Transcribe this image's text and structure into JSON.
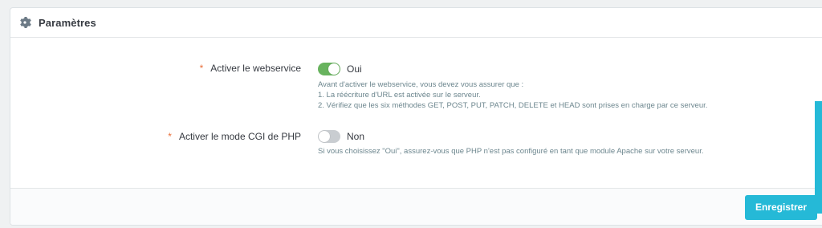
{
  "panel": {
    "title": "Paramètres",
    "icon": "gear-icon"
  },
  "fields": [
    {
      "required_mark": "*",
      "label": "Activer le webservice",
      "enabled": true,
      "state_label": "Oui",
      "help": [
        "Avant d'activer le webservice, vous devez vous assurer que :",
        "1. La réécriture d'URL est activée sur le serveur.",
        "2. Vérifiez que les six méthodes GET, POST, PUT, PATCH, DELETE et HEAD sont prises en charge par ce serveur."
      ]
    },
    {
      "required_mark": "*",
      "label": "Activer le mode CGI de PHP",
      "enabled": false,
      "state_label": "Non",
      "help": [
        "Si vous choisissez \"Oui\", assurez-vous que PHP n'est pas configuré en tant que module Apache sur votre serveur."
      ]
    }
  ],
  "footer": {
    "save_label": "Enregistrer"
  },
  "colors": {
    "toggle_on": "#68b35e",
    "toggle_off": "#c9cdd1",
    "required": "#e96f3a",
    "primary": "#25b9d7"
  }
}
